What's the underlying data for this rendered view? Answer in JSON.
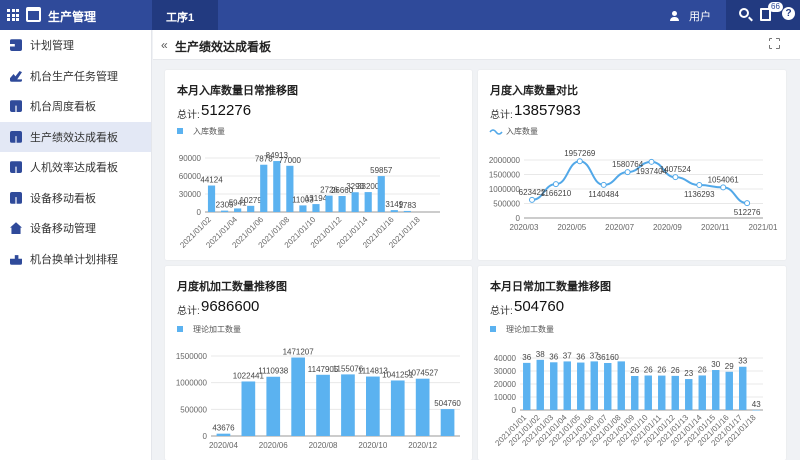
{
  "topbar": {
    "app_title": "生产管理",
    "tab": "工序1",
    "user": "用户",
    "badge": "66",
    "help": "?"
  },
  "sidebar": {
    "items": [
      {
        "label": "计划管理",
        "icon": "plan-icon",
        "active": false
      },
      {
        "label": "机台生产任务管理",
        "icon": "task-chart-icon",
        "active": false
      },
      {
        "label": "机台周度看板",
        "icon": "board-icon",
        "active": false
      },
      {
        "label": "生产绩效达成看板",
        "icon": "board-icon",
        "active": true
      },
      {
        "label": "人机效率达成看板",
        "icon": "board-icon",
        "active": false
      },
      {
        "label": "设备移动看板",
        "icon": "board-icon",
        "active": false
      },
      {
        "label": "设备移动管理",
        "icon": "home-icon",
        "active": false
      },
      {
        "label": "机台换单计划排程",
        "icon": "schedule-icon",
        "active": false
      }
    ]
  },
  "page": {
    "back": "«",
    "title": "生产绩效达成看板"
  },
  "total_label": "总计:",
  "colors": {
    "bar": "#5bb2f0",
    "line": "#52a8e8",
    "primary": "#2f4a9a"
  },
  "cards": [
    {
      "title": "本月入库数量日常推移图",
      "total": "512276",
      "legend": "入库数量",
      "chart_data": {
        "type": "bar",
        "categories": [
          "2021/01/02",
          "",
          "2021/01/04",
          "",
          "2021/01/06",
          "",
          "2021/01/08",
          "",
          "2021/01/10",
          "",
          "2021/01/12",
          "",
          "2021/01/14",
          "",
          "2021/01/16",
          "",
          "2021/01/18",
          ""
        ],
        "values": [
          44124,
          2305,
          5941,
          10279,
          78784,
          84913,
          77000,
          11003,
          13194,
          27262,
          26660,
          32927,
          33200,
          59857,
          3149,
          1783,
          0,
          0
        ],
        "labels": [
          "44124",
          "2305",
          "5941",
          "10279",
          "7878",
          "84913",
          "77000",
          "11003",
          "13194",
          "2726",
          "26660",
          "3293",
          "33200",
          "59857",
          "3149",
          "1783",
          "",
          ""
        ],
        "yticks": [
          "90000",
          "60000",
          "30000",
          "0"
        ],
        "ylim": [
          0,
          90000
        ]
      }
    },
    {
      "title": "月度入库数量对比",
      "total": "13857983",
      "legend": "入库数量",
      "chart_data": {
        "type": "line",
        "categories": [
          "2020/03",
          "2020/04",
          "2020/05",
          "2020/06",
          "2020/07",
          "2020/08",
          "2020/09",
          "2020/10",
          "2020/11",
          "2020/12",
          "2021/01"
        ],
        "xtick_labels": [
          "2020/03",
          "2020/05",
          "2020/07",
          "2020/09",
          "2020/11",
          "2021/01"
        ],
        "values": [
          623422,
          1166210,
          1957269,
          1140484,
          1580764,
          1937404,
          1407524,
          1136293,
          1054061,
          512276
        ],
        "labels": [
          "623422",
          "1166210",
          "1957269",
          "1140484",
          "1580764",
          "1937404",
          "1407524",
          "1136293",
          "1054061",
          "512276"
        ],
        "yticks": [
          "2000000",
          "1500000",
          "1000000",
          "500000",
          "0"
        ],
        "ylim": [
          0,
          2000000
        ]
      }
    },
    {
      "title": "月度机加工数量推移图",
      "total": "9686600",
      "legend": "理论加工数量",
      "chart_data": {
        "type": "bar",
        "categories": [
          "2020/04",
          "2020/05",
          "2020/06",
          "2020/07",
          "2020/08",
          "2020/09",
          "2020/10",
          "2020/11",
          "2020/12",
          "2021/01"
        ],
        "xtick_labels": [
          "2020/04",
          "2020/06",
          "2020/08",
          "2020/10",
          "2020/12"
        ],
        "values": [
          43676,
          1022441,
          1110938,
          1471207,
          1147905,
          1155076,
          1114813,
          1041251,
          1074527,
          504760
        ],
        "labels": [
          "43676",
          "1022441",
          "1110938",
          "1471207",
          "1147905",
          "1155076",
          "1114813",
          "1041251",
          "1074527",
          "504760"
        ],
        "yticks": [
          "1500000",
          "1000000",
          "500000",
          "0"
        ],
        "ylim": [
          0,
          1500000
        ]
      }
    },
    {
      "title": "本月日常加工数量推移图",
      "total": "504760",
      "legend": "理论加工数量",
      "chart_data": {
        "type": "bar",
        "categories": [
          "2021/01/01",
          "2021/01/02",
          "2021/01/03",
          "2021/01/04",
          "2021/01/05",
          "2021/01/06",
          "2021/01/07",
          "2021/01/08",
          "2021/01/09",
          "2021/01/10",
          "2021/01/11",
          "2021/01/12",
          "2021/01/13",
          "2021/01/14",
          "2021/01/15",
          "2021/01/16",
          "2021/01/17",
          "2021/01/18"
        ],
        "values": [
          36250,
          38600,
          36700,
          37370,
          36500,
          37400,
          36160,
          37400,
          26150,
          26530,
          26460,
          26240,
          23800,
          26570,
          30750,
          29400,
          33270,
          43
        ],
        "labels": [
          "36",
          "38",
          "36",
          "37",
          "36",
          "37",
          "36160",
          "",
          "26",
          "26",
          "26",
          "26",
          "23",
          "26",
          "30",
          "29",
          "33",
          "43"
        ],
        "yticks": [
          "40000",
          "30000",
          "20000",
          "10000",
          "0"
        ],
        "ylim": [
          0,
          40000
        ]
      }
    }
  ]
}
